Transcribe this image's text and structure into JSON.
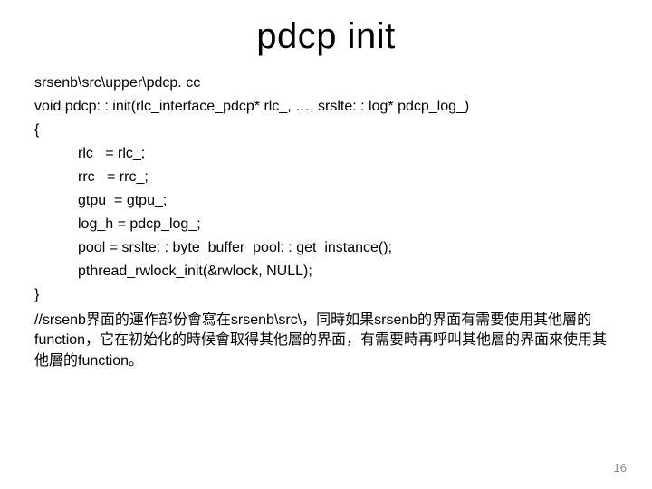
{
  "title": "pdcp init",
  "filepath": "srsenb\\src\\upper\\pdcp. cc",
  "signature": "void pdcp: : init(rlc_interface_pdcp* rlc_, …, srslte: : log* pdcp_log_)",
  "brace_open": "{",
  "brace_close": "}",
  "code_lines": [
    "rlc   = rlc_;",
    "rrc   = rrc_;",
    "gtpu  = gtpu_;",
    "log_h = pdcp_log_;",
    "pool = srslte: : byte_buffer_pool: : get_instance();",
    "pthread_rwlock_init(&rwlock, NULL);"
  ],
  "comment": "//srsenb界面的運作部份會寫在srsenb\\src\\，同時如果srsenb的界面有需要使用其他層的function，它在初始化的時候會取得其他層的界面，有需要時再呼叫其他層的界面來使用其他層的function。",
  "page_number": "16"
}
